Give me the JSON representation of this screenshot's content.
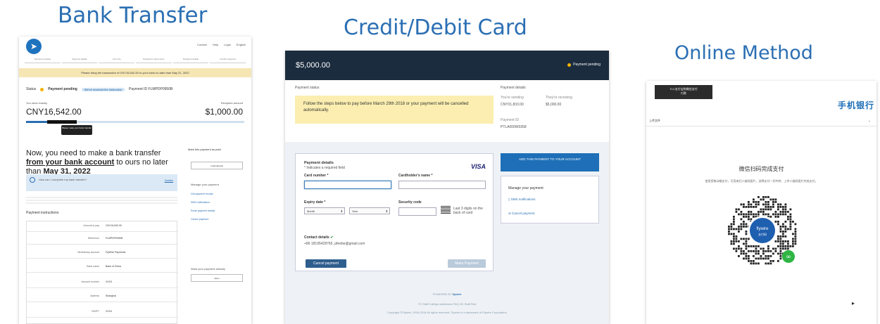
{
  "headings": {
    "bank": "Bank Transfer",
    "card": "Credit/Debit Card",
    "online": "Online Method"
  },
  "bank": {
    "logo_icon": "paper-plane-icon",
    "nav": [
      "Contact",
      "Help",
      "Login",
      "English"
    ],
    "steps": [
      "Payment sending",
      "Payment details",
      "Your info",
      "Recipient's documents",
      "Recipient details",
      "Confirm payment"
    ],
    "notice": "Please bring the transaction of CNY16,542.00 to your bank no later than May 31, 2022",
    "status_label": "Status",
    "status_value": "Payment pending",
    "status_pill": "We've received the instruction",
    "payment_id": "Payment ID  FLMPDP0950B",
    "you_send_label": "You send exactly",
    "amount_left": "CNY16,542.00",
    "recipient_label": "Recipient amount",
    "amount_right": "$1,000.00",
    "progress": 0.12,
    "tooltip": "Please make your bank transfer",
    "main_title_pre": "Now, you need to make a bank transfer ",
    "main_title_link": "from your bank account",
    "main_title_mid": " to ours no later than ",
    "main_title_date": "May 31, 2022",
    "info_title": "How can I complete my bank transfer?",
    "info_link": "Details",
    "instructions_title": "Payment instructions",
    "rows": [
      {
        "k": "Amount to pay",
        "v": "CNY16,542.00"
      },
      {
        "k": "Reference",
        "v": "FLMPDP0950B"
      },
      {
        "k": "Beneficiary account",
        "v": "FlyWire Payments"
      },
      {
        "k": "Bank name",
        "v": "Bank of China"
      },
      {
        "k": "Account number",
        "v": "XXXX"
      },
      {
        "k": "Address",
        "v": "Shanghai"
      },
      {
        "k": "SWIFT",
        "v": "XXXX"
      }
    ],
    "side_heading": "Mark this payment as paid",
    "side_btn1": "I paid already",
    "side_manage": "Manage your payment",
    "side_items": [
      "Get payment receipt",
      "SMS notifications",
      "Email payment details",
      "Cancel payment"
    ],
    "side_question": "Want your payment already",
    "side_btn2": "Open"
  },
  "card": {
    "amount": "$5,000.00",
    "status_badge": "Payment pending",
    "payment_status_label": "Payment status",
    "warning": "Follow the steps below to pay before March 29th 2018 or your payment will be cancelled automatically.",
    "details_label": "Payment details",
    "sending_label": "You're sending",
    "sending_value": "CNY31,833.00",
    "receiving_label": "They're receiving",
    "receiving_value": "$5,000.00",
    "payment_id_label": "Payment ID",
    "payment_id": "PTLA000W0358",
    "form_title": "Payment details",
    "required_note": "* Indicates a required field",
    "brand": "VISA",
    "card_number_label": "Card number *",
    "cardholder_label": "Cardholder's name *",
    "expiry_label": "Expiry date *",
    "month_option": "Month",
    "year_option": "Year",
    "security_label": "Security code",
    "security_hint": "Last 3 digits on the back of card",
    "contact_label": "Contact details",
    "contact_value": "+86 18195428765, pfeebe@gmail.com",
    "cancel_btn": "Cancel payment",
    "pay_btn": "Make Payment",
    "add_btn": "ADD THIS PAYMENT TO YOUR ACCOUNT",
    "manage_title": "Manage your payment",
    "sms": "SMS notifications",
    "cancel_link": "Cancel payment",
    "powered_by": "POWERED BY",
    "powered_brand": "flywire",
    "footer_line1": "TC  Staff College  addresses  FAQ  HC  Staff Red",
    "footer_line2": "Copyright ©Flywire, 2009-2018 All rights reserved. Flywire is a trademark of Flywire Corporation"
  },
  "online": {
    "badge": "TLC支付宝和微信支付\n付款",
    "brand": "手机银行",
    "lang": "上传文件",
    "title": "微信扫码完成支付",
    "desc": "使用您移动端支付，可用来扫二维码图片，选择支付一切中转，上传二维码图片完成支付。",
    "qr_label": "flywire",
    "qr_sub": "支付码"
  }
}
